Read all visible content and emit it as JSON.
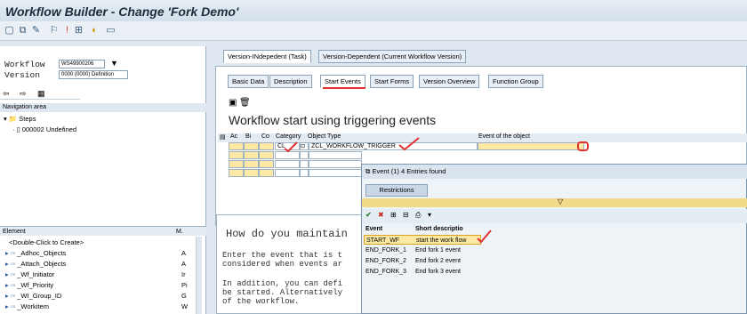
{
  "app": {
    "title": "Workflow Builder - Change 'Fork Demo'"
  },
  "left": {
    "workflow_label": "Workflow",
    "workflow_value": "WS49900206",
    "version_label": "Version",
    "version_value": "0000 (0000) Definition",
    "nav_title": "Navigation area",
    "steps_label": "Steps",
    "step_item": "000002 Undefined",
    "el_col1": "Element",
    "el_col2": "M.",
    "elements": [
      {
        "name": "<Double-Click to Create>",
        "m": ""
      },
      {
        "name": "_Adhoc_Objects",
        "m": "A"
      },
      {
        "name": "_Attach_Objects",
        "m": "A"
      },
      {
        "name": "_Wf_Initiator",
        "m": "Ir"
      },
      {
        "name": "_Wf_Priority",
        "m": "Pi"
      },
      {
        "name": "_WI_Group_ID",
        "m": "G"
      },
      {
        "name": "_Workitem",
        "m": "W"
      }
    ]
  },
  "tabs_top": [
    "Version-INdepedent (Task)",
    "Version-Dependent (Current Workflow Version)"
  ],
  "tabs": [
    "Basic Data",
    "Description",
    "Start Events",
    "Start Forms",
    "Version Overview",
    "Function Group"
  ],
  "section_title": "Workflow start using triggering events",
  "grid": {
    "cols": [
      "Ac",
      "Bi",
      "Co",
      "Category",
      "Object Type",
      "Event of the object"
    ],
    "row1_cat": "CL",
    "row1_obj": "ZCL_WORKFLOW_TRIGGER"
  },
  "doc": {
    "heading": "How do you maintain",
    "lines": [
      "Enter the event that is t",
      "considered when events ar",
      "",
      "In addition, you can defi",
      "be started. Alternatively",
      "of the workflow."
    ]
  },
  "popup": {
    "title": "Event (1)   4 Entries found",
    "restrictions": "Restrictions",
    "col1": "Event",
    "col2": "Short descriptio",
    "rows": [
      {
        "event": "START_WF",
        "desc": "start the work flow"
      },
      {
        "event": "END_FORK_1",
        "desc": "End fork 1 event"
      },
      {
        "event": "END_FORK_2",
        "desc": "End fork 2 event"
      },
      {
        "event": "END_FORK_3",
        "desc": "End fork 3 event"
      }
    ]
  }
}
